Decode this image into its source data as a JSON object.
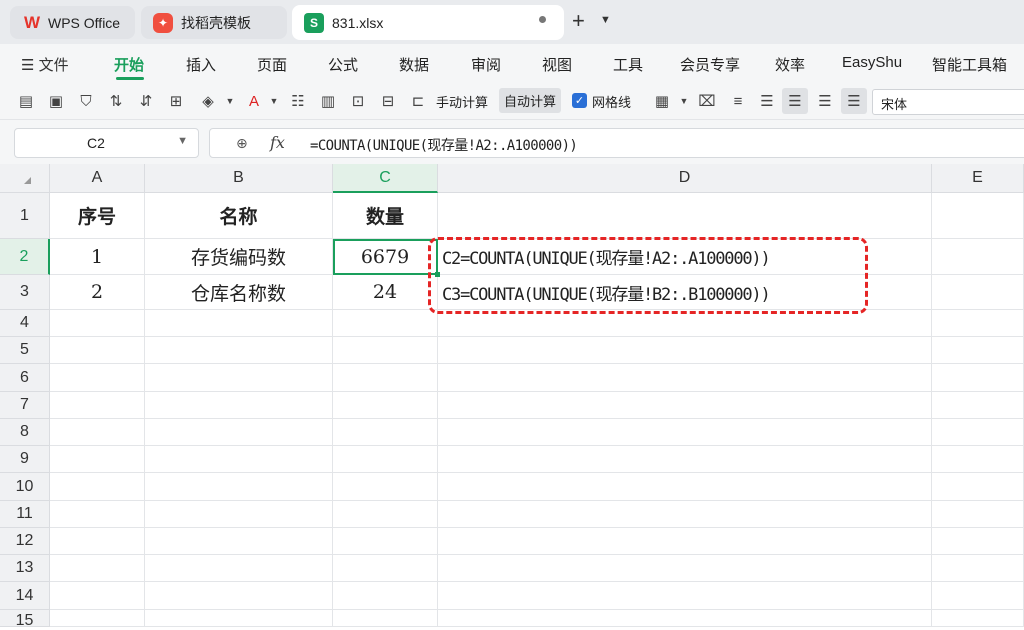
{
  "tabs": [
    {
      "label": "WPS Office",
      "icon": "wps-logo-icon"
    },
    {
      "label": "找稻壳模板",
      "icon": "docer-icon"
    },
    {
      "label": "831.xlsx",
      "icon": "spreadsheet-icon",
      "active": true
    }
  ],
  "menu": {
    "file": "文件",
    "items": [
      "开始",
      "插入",
      "页面",
      "公式",
      "数据",
      "审阅",
      "视图",
      "工具",
      "会员专享",
      "效率",
      "EasyShu",
      "智能工具箱"
    ],
    "active": "开始"
  },
  "toolbar": {
    "manual_calc": "手动计算",
    "auto_calc": "自动计算",
    "gridlines": "网格线",
    "font": "宋体"
  },
  "formula_bar": {
    "name_box": "C2",
    "formula": "=COUNTA(UNIQUE(现存量!A2:.A100000))"
  },
  "grid": {
    "columns": [
      "A",
      "B",
      "C",
      "D",
      "E"
    ],
    "selected_column": "C",
    "rows": [
      "1",
      "2",
      "3",
      "4",
      "5",
      "6",
      "7",
      "8",
      "9",
      "10",
      "11",
      "12",
      "13",
      "14",
      "15"
    ],
    "selected_row": "2",
    "cells": {
      "A1": "序号",
      "B1": "名称",
      "C1": "数量",
      "A2": "1",
      "B2": "存货编码数",
      "C2": "6679",
      "D2": "C2=COUNTA(UNIQUE(现存量!A2:.A100000))",
      "A3": "2",
      "B3": "仓库名称数",
      "C3": "24",
      "D3": "C3=COUNTA(UNIQUE(现存量!B2:.B100000))"
    }
  },
  "colors": {
    "accent": "#1a9f5c",
    "annotation": "#e52525"
  }
}
